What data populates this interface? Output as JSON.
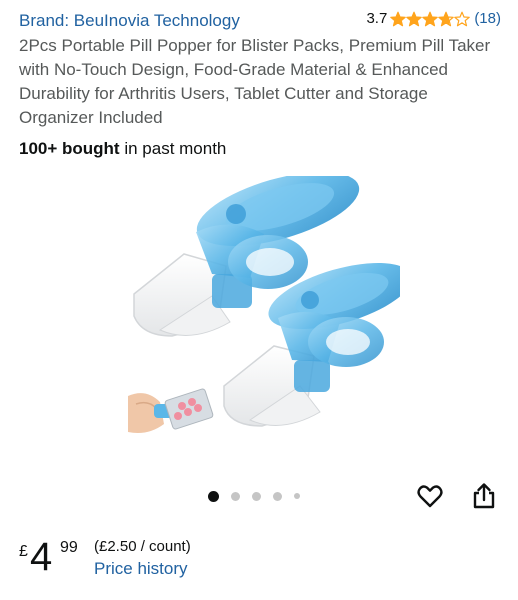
{
  "brand": {
    "label": "Brand: BeuInovia Technology"
  },
  "rating": {
    "value": "3.7",
    "stars": 3.7,
    "review_count": "(18)",
    "star_color": "#ffa41c"
  },
  "product": {
    "title": "2Pcs Portable Pill Popper for Blister Packs, Premium Pill Taker with No-Touch Design, Food-Grade Material & Enhanced Durability for Arthritis Users, Tablet Cutter and Storage Organizer Included",
    "bought_bold": "100+ bought",
    "bought_rest": " in past month"
  },
  "gallery": {
    "image_count": 5,
    "active_index": 0
  },
  "actions": {
    "favorite_icon": "heart-outline-icon",
    "share_icon": "share-icon"
  },
  "price": {
    "currency": "£",
    "whole": "4",
    "fraction": "99",
    "unit_price": "(£2.50 / count)",
    "history_link": "Price history"
  },
  "colors": {
    "link": "#2162a1",
    "text": "#0f1111",
    "secondary_text": "#565959",
    "accent_blue": "#5bb7e8"
  }
}
